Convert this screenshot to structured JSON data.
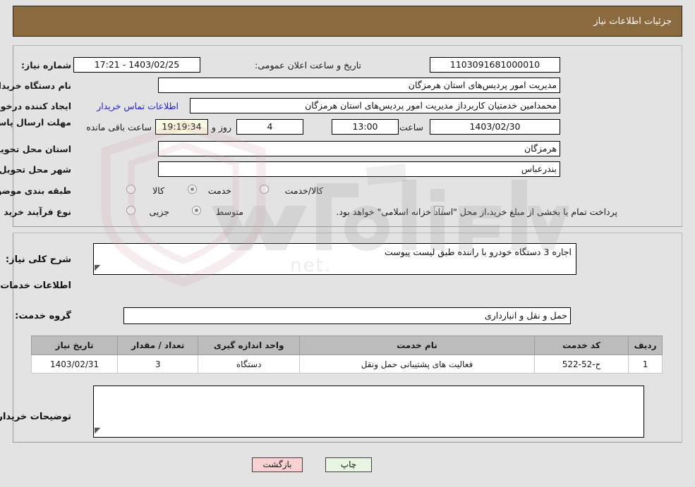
{
  "header": {
    "title": "جزئیات اطلاعات نیاز",
    "bg_color": "#8c6a3f"
  },
  "top_panel": {
    "need_number": {
      "label": "شماره نیاز:",
      "value": "1103091681000010"
    },
    "announce_datetime": {
      "label": "تاریخ و ساعت اعلان عمومی:",
      "value": "1403/02/25 - 17:21"
    },
    "buyer_org": {
      "label": "نام دستگاه خریدار:",
      "value": "مدیریت امور پردیس‌های استان هرمزگان"
    },
    "requester": {
      "label": "ایجاد کننده درخواست:",
      "value": "محمدامین خدمتیان کاربرداز مدیریت امور پردیس‌های استان هرمزگان"
    },
    "contact_link": "اطلاعات تماس خریدار",
    "deadline": {
      "label": "مهلت ارسال پاسخ: تا تاریخ:",
      "date": "1403/02/30",
      "time_label": "ساعت",
      "time": "13:00",
      "days": "4",
      "days_suffix": "روز و",
      "remaining_clock": "19:19:34",
      "remaining_suffix": "ساعت باقی مانده"
    },
    "province": {
      "label": "استان محل تحویل:",
      "value": "هرمزگان"
    },
    "city": {
      "label": "شهر محل تحویل:",
      "value": "بندرعباس"
    },
    "category": {
      "label": "طبقه بندی موضوعی:",
      "options": [
        "کالا",
        "خدمت",
        "کالا/خدمت"
      ],
      "selected": "خدمت"
    },
    "purchase_type": {
      "label": "نوع فرآیند خرید :",
      "options": [
        "جزیی",
        "متوسط"
      ],
      "selected": "متوسط",
      "checkbox_text": "پرداخت تمام یا بخشی از مبلغ خرید،از محل \"اسناد خزانه اسلامی\" خواهد بود.",
      "checkbox_checked": false
    }
  },
  "mid_panel": {
    "general_desc": {
      "label": "شرح کلی نیاز:",
      "value": "اجاره 3 دستگاه خودرو با راننده طبق لیست پیوست"
    },
    "section_heading": "اطلاعات خدمات مورد نیاز",
    "service_group": {
      "label": "گروه خدمت:",
      "value": "حمل و نقل و انبارداری"
    },
    "table": {
      "columns": [
        "ردیف",
        "کد خدمت",
        "نام خدمت",
        "واحد اندازه گیری",
        "تعداد / مقدار",
        "تاریخ نیاز"
      ],
      "rows": [
        {
          "row": "1",
          "code": "ح-52-522",
          "name": "فعالیت های پشتیبانی حمل ونقل",
          "unit": "دستگاه",
          "qty": "3",
          "need_date": "1403/02/31"
        }
      ]
    },
    "buyer_notes": {
      "label": "توضیحات خریدار:",
      "value": ""
    }
  },
  "footer": {
    "back_button": "بازگشت",
    "print_button": "چاپ"
  }
}
